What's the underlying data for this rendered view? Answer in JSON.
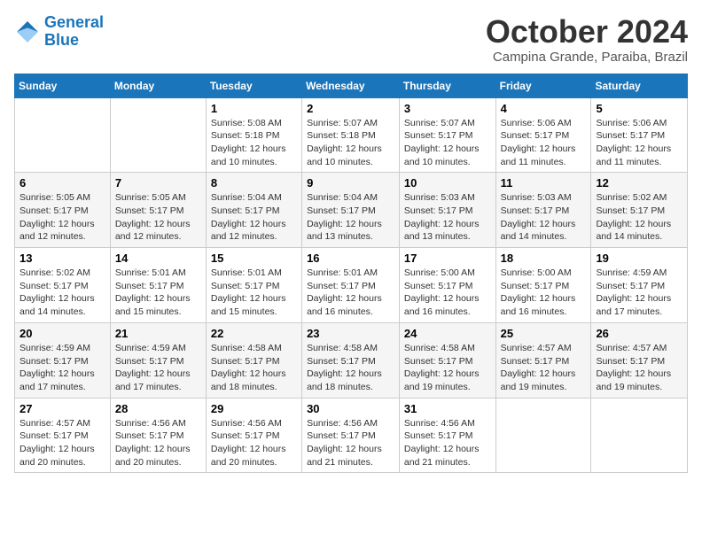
{
  "header": {
    "logo_line1": "General",
    "logo_line2": "Blue",
    "month": "October 2024",
    "location": "Campina Grande, Paraiba, Brazil"
  },
  "weekdays": [
    "Sunday",
    "Monday",
    "Tuesday",
    "Wednesday",
    "Thursday",
    "Friday",
    "Saturday"
  ],
  "weeks": [
    [
      {
        "day": "",
        "info": ""
      },
      {
        "day": "",
        "info": ""
      },
      {
        "day": "1",
        "info": "Sunrise: 5:08 AM\nSunset: 5:18 PM\nDaylight: 12 hours and 10 minutes."
      },
      {
        "day": "2",
        "info": "Sunrise: 5:07 AM\nSunset: 5:18 PM\nDaylight: 12 hours and 10 minutes."
      },
      {
        "day": "3",
        "info": "Sunrise: 5:07 AM\nSunset: 5:17 PM\nDaylight: 12 hours and 10 minutes."
      },
      {
        "day": "4",
        "info": "Sunrise: 5:06 AM\nSunset: 5:17 PM\nDaylight: 12 hours and 11 minutes."
      },
      {
        "day": "5",
        "info": "Sunrise: 5:06 AM\nSunset: 5:17 PM\nDaylight: 12 hours and 11 minutes."
      }
    ],
    [
      {
        "day": "6",
        "info": "Sunrise: 5:05 AM\nSunset: 5:17 PM\nDaylight: 12 hours and 12 minutes."
      },
      {
        "day": "7",
        "info": "Sunrise: 5:05 AM\nSunset: 5:17 PM\nDaylight: 12 hours and 12 minutes."
      },
      {
        "day": "8",
        "info": "Sunrise: 5:04 AM\nSunset: 5:17 PM\nDaylight: 12 hours and 12 minutes."
      },
      {
        "day": "9",
        "info": "Sunrise: 5:04 AM\nSunset: 5:17 PM\nDaylight: 12 hours and 13 minutes."
      },
      {
        "day": "10",
        "info": "Sunrise: 5:03 AM\nSunset: 5:17 PM\nDaylight: 12 hours and 13 minutes."
      },
      {
        "day": "11",
        "info": "Sunrise: 5:03 AM\nSunset: 5:17 PM\nDaylight: 12 hours and 14 minutes."
      },
      {
        "day": "12",
        "info": "Sunrise: 5:02 AM\nSunset: 5:17 PM\nDaylight: 12 hours and 14 minutes."
      }
    ],
    [
      {
        "day": "13",
        "info": "Sunrise: 5:02 AM\nSunset: 5:17 PM\nDaylight: 12 hours and 14 minutes."
      },
      {
        "day": "14",
        "info": "Sunrise: 5:01 AM\nSunset: 5:17 PM\nDaylight: 12 hours and 15 minutes."
      },
      {
        "day": "15",
        "info": "Sunrise: 5:01 AM\nSunset: 5:17 PM\nDaylight: 12 hours and 15 minutes."
      },
      {
        "day": "16",
        "info": "Sunrise: 5:01 AM\nSunset: 5:17 PM\nDaylight: 12 hours and 16 minutes."
      },
      {
        "day": "17",
        "info": "Sunrise: 5:00 AM\nSunset: 5:17 PM\nDaylight: 12 hours and 16 minutes."
      },
      {
        "day": "18",
        "info": "Sunrise: 5:00 AM\nSunset: 5:17 PM\nDaylight: 12 hours and 16 minutes."
      },
      {
        "day": "19",
        "info": "Sunrise: 4:59 AM\nSunset: 5:17 PM\nDaylight: 12 hours and 17 minutes."
      }
    ],
    [
      {
        "day": "20",
        "info": "Sunrise: 4:59 AM\nSunset: 5:17 PM\nDaylight: 12 hours and 17 minutes."
      },
      {
        "day": "21",
        "info": "Sunrise: 4:59 AM\nSunset: 5:17 PM\nDaylight: 12 hours and 17 minutes."
      },
      {
        "day": "22",
        "info": "Sunrise: 4:58 AM\nSunset: 5:17 PM\nDaylight: 12 hours and 18 minutes."
      },
      {
        "day": "23",
        "info": "Sunrise: 4:58 AM\nSunset: 5:17 PM\nDaylight: 12 hours and 18 minutes."
      },
      {
        "day": "24",
        "info": "Sunrise: 4:58 AM\nSunset: 5:17 PM\nDaylight: 12 hours and 19 minutes."
      },
      {
        "day": "25",
        "info": "Sunrise: 4:57 AM\nSunset: 5:17 PM\nDaylight: 12 hours and 19 minutes."
      },
      {
        "day": "26",
        "info": "Sunrise: 4:57 AM\nSunset: 5:17 PM\nDaylight: 12 hours and 19 minutes."
      }
    ],
    [
      {
        "day": "27",
        "info": "Sunrise: 4:57 AM\nSunset: 5:17 PM\nDaylight: 12 hours and 20 minutes."
      },
      {
        "day": "28",
        "info": "Sunrise: 4:56 AM\nSunset: 5:17 PM\nDaylight: 12 hours and 20 minutes."
      },
      {
        "day": "29",
        "info": "Sunrise: 4:56 AM\nSunset: 5:17 PM\nDaylight: 12 hours and 20 minutes."
      },
      {
        "day": "30",
        "info": "Sunrise: 4:56 AM\nSunset: 5:17 PM\nDaylight: 12 hours and 21 minutes."
      },
      {
        "day": "31",
        "info": "Sunrise: 4:56 AM\nSunset: 5:17 PM\nDaylight: 12 hours and 21 minutes."
      },
      {
        "day": "",
        "info": ""
      },
      {
        "day": "",
        "info": ""
      }
    ]
  ]
}
